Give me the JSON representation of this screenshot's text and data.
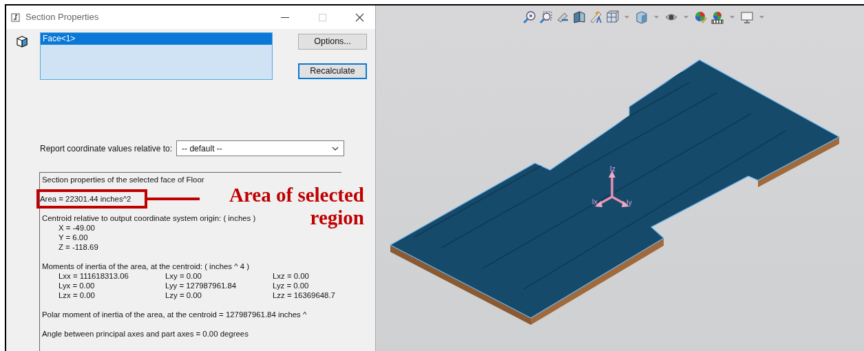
{
  "dialog": {
    "title": "Section Properties",
    "selection_list": {
      "items": [
        {
          "label": "Face<1>",
          "selected": true
        }
      ]
    },
    "buttons": [
      {
        "label": "Options...",
        "default": false
      },
      {
        "label": "Recalculate",
        "default": true
      }
    ],
    "report": {
      "label": "Report coordinate values relative to:",
      "value": "-- default --"
    },
    "results": {
      "sections": [
        {
          "lines": [
            {
              "kind": "text",
              "text": "Section properties of the selected face of Floor"
            }
          ]
        },
        {
          "lines": [
            {
              "kind": "text",
              "text": "Area = 22301.44 inches^2",
              "annotated": true
            }
          ]
        },
        {
          "lines": [
            {
              "kind": "text",
              "text": "Centroid relative to output coordinate system origin: ( inches )"
            },
            {
              "kind": "indent",
              "text": "X = -49.00"
            },
            {
              "kind": "indent",
              "text": "Y = 6.00"
            },
            {
              "kind": "indent",
              "text": "Z = -118.69"
            }
          ]
        },
        {
          "lines": [
            {
              "kind": "text",
              "text": "Moments of inertia of the area, at the centroid: ( inches ^ 4 )"
            },
            {
              "kind": "grid",
              "cells": [
                "Lxx = 111618313.06",
                "Lxy = 0.00",
                "Lxz = 0.00"
              ]
            },
            {
              "kind": "grid",
              "cells": [
                "Lyx = 0.00",
                "Lyy = 127987961.84",
                "Lyz = 0.00"
              ]
            },
            {
              "kind": "grid",
              "cells": [
                "Lzx = 0.00",
                "Lzy = 0.00",
                "Lzz = 16369648.7"
              ]
            }
          ]
        },
        {
          "lines": [
            {
              "kind": "text",
              "text": "Polar moment of inertia of the area, at the centroid = 127987961.84 inches ^"
            }
          ]
        },
        {
          "lines": [
            {
              "kind": "text",
              "text": "Angle between principal axes and part axes = 0.00 degrees"
            }
          ]
        }
      ]
    }
  },
  "annotation": {
    "text_lines": [
      "Area of selected",
      "region"
    ]
  },
  "viewport": {
    "axis_labels": [
      "lz",
      "lx",
      "ly"
    ]
  }
}
